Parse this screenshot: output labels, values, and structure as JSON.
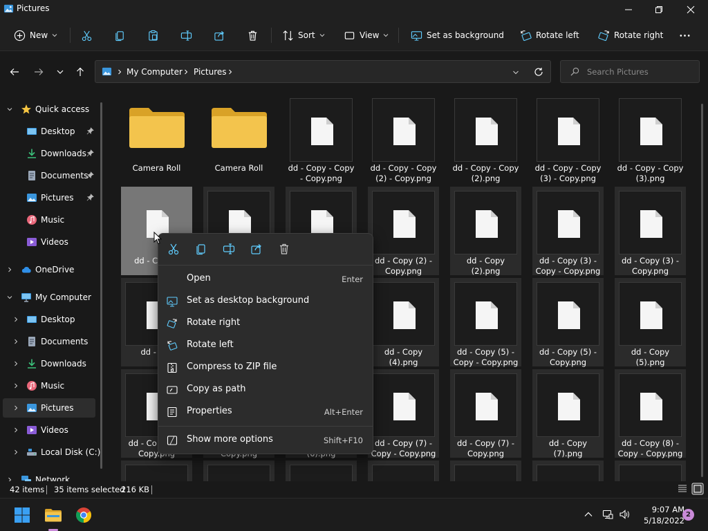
{
  "window": {
    "title": "Pictures"
  },
  "toolbar": {
    "new_label": "New",
    "sort_label": "Sort",
    "view_label": "View",
    "set_bg_label": "Set as background",
    "rotate_left_label": "Rotate left",
    "rotate_right_label": "Rotate right"
  },
  "address": {
    "crumbs": [
      "My Computer",
      "Pictures"
    ],
    "search_placeholder": "Search Pictures"
  },
  "sidebar": {
    "items": [
      {
        "label": "Quick access"
      },
      {
        "label": "Desktop"
      },
      {
        "label": "Downloads"
      },
      {
        "label": "Documents"
      },
      {
        "label": "Pictures"
      },
      {
        "label": "Music"
      },
      {
        "label": "Videos"
      },
      {
        "label": "OneDrive"
      },
      {
        "label": "My Computer"
      },
      {
        "label": "Desktop"
      },
      {
        "label": "Documents"
      },
      {
        "label": "Downloads"
      },
      {
        "label": "Music"
      },
      {
        "label": "Pictures"
      },
      {
        "label": "Videos"
      },
      {
        "label": "Local Disk (C:)"
      },
      {
        "label": "Network"
      }
    ]
  },
  "files": [
    {
      "name": "Camera Roll"
    },
    {
      "name": "Camera Roll"
    },
    {
      "name": "dd - Copy - Copy - Copy.png"
    },
    {
      "name": "dd - Copy - Copy (2) - Copy.png"
    },
    {
      "name": "dd - Copy - Copy (2).png"
    },
    {
      "name": "dd - Copy - Copy (3) - Copy.png"
    },
    {
      "name": "dd - Copy - Copy (3).png"
    },
    {
      "name": "dd - Co (4)."
    },
    {
      "name": ""
    },
    {
      "name": ""
    },
    {
      "name": "dd - Copy (2) - Copy.png"
    },
    {
      "name": "dd - Copy (2).png"
    },
    {
      "name": "dd - Copy (3) - Copy - Copy.png"
    },
    {
      "name": "dd - Copy (3) - Copy.png"
    },
    {
      "name": "dd - (3)."
    },
    {
      "name": ""
    },
    {
      "name": ""
    },
    {
      "name": "dd - Copy (4).png"
    },
    {
      "name": "dd - Copy (5) - Copy - Copy.png"
    },
    {
      "name": "dd - Copy (5) - Copy.png"
    },
    {
      "name": "dd - Copy (5).png"
    },
    {
      "name": "dd - Co Copy - Copy.png"
    },
    {
      "name": "Copy.png"
    },
    {
      "name": "(6).png"
    },
    {
      "name": "dd - Copy (7) - Copy - Copy.png"
    },
    {
      "name": "dd - Copy (7) - Copy.png"
    },
    {
      "name": "dd - Copy (7).png"
    },
    {
      "name": "dd - Copy (8) - Copy - Copy.png"
    }
  ],
  "context_menu": {
    "items": [
      {
        "label": "Open",
        "shortcut": "Enter"
      },
      {
        "label": "Set as desktop background",
        "shortcut": ""
      },
      {
        "label": "Rotate right",
        "shortcut": ""
      },
      {
        "label": "Rotate left",
        "shortcut": ""
      },
      {
        "label": "Compress to ZIP file",
        "shortcut": ""
      },
      {
        "label": "Copy as path",
        "shortcut": ""
      },
      {
        "label": "Properties",
        "shortcut": "Alt+Enter"
      },
      {
        "label": "Show more options",
        "shortcut": "Shift+F10"
      }
    ]
  },
  "status": {
    "items_count": "42 items",
    "selected": "35 items selected",
    "size": "216 KB"
  },
  "taskbar": {
    "time": "9:07 AM",
    "date": "5/18/2022",
    "notifications": "2"
  },
  "colors": {
    "accent": "#60cdff",
    "folder": "#f3c44d",
    "badge": "#c98ad8"
  }
}
